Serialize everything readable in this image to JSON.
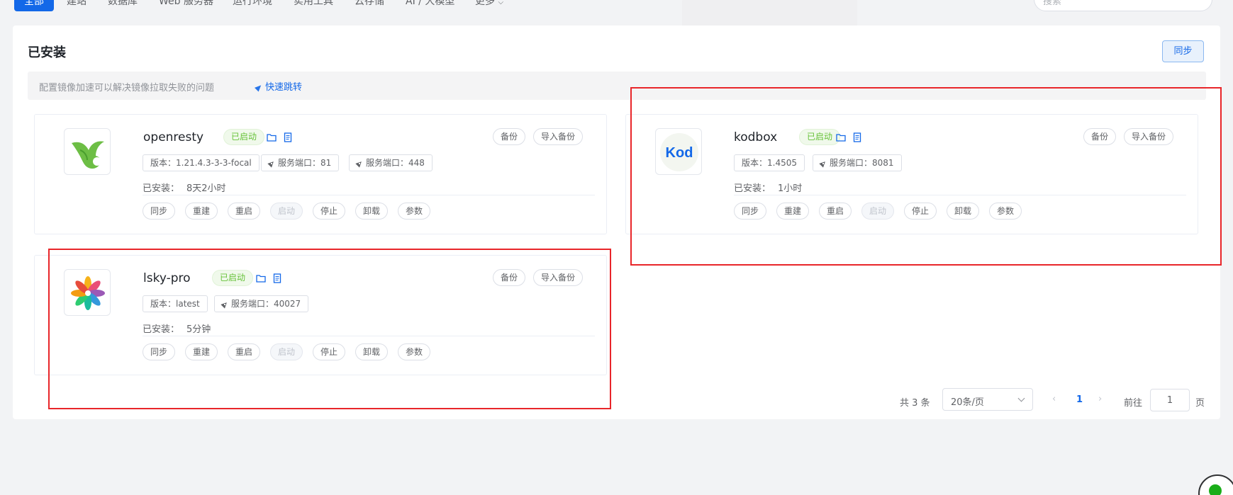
{
  "nav": {
    "tabs": [
      "全部",
      "建站",
      "数据库",
      "Web 服务器",
      "运行环境",
      "实用工具",
      "云存储",
      "AI / 大模型",
      "更多"
    ],
    "active_index": 0,
    "search_placeholder": "搜索"
  },
  "installed": {
    "title": "已安装",
    "sync_label": "同步",
    "notice_text": "配置镜像加速可以解决镜像拉取失败的问题",
    "notice_link": "快速跳转"
  },
  "apps": [
    {
      "name": "openresty",
      "status": "已启动",
      "version": "版本：1.21.4.3-3-3-focal",
      "ports": [
        "服务端口：81",
        "服务端口：448"
      ],
      "installed_label": "已安装：",
      "installed_value": "8天2小时",
      "backup_label": "备份",
      "import_label": "导入备份",
      "actions": [
        "同步",
        "重建",
        "重启",
        "启动",
        "停止",
        "卸载",
        "参数"
      ],
      "disabled_action": "启动"
    },
    {
      "name": "kodbox",
      "status": "已启动",
      "version": "版本：1.4505",
      "ports": [
        "服务端口：8081"
      ],
      "installed_label": "已安装：",
      "installed_value": "1小时",
      "backup_label": "备份",
      "import_label": "导入备份",
      "actions": [
        "同步",
        "重建",
        "重启",
        "启动",
        "停止",
        "卸载",
        "参数"
      ],
      "disabled_action": "启动"
    },
    {
      "name": "lsky-pro",
      "status": "已启动",
      "version": "版本：latest",
      "ports": [
        "服务端口：40027"
      ],
      "installed_label": "已安装：",
      "installed_value": "5分钟",
      "backup_label": "备份",
      "import_label": "导入备份",
      "actions": [
        "同步",
        "重建",
        "重启",
        "启动",
        "停止",
        "卸载",
        "参数"
      ],
      "disabled_action": "启动"
    }
  ],
  "kodbox_logo_text": "Kod",
  "pagination": {
    "total": "共 3 条",
    "page_size": "20条/页",
    "prev": "‹",
    "current_page": "1",
    "next": "›",
    "goto_label": "前往",
    "goto_value": "1",
    "unit": "页"
  },
  "colors": {
    "primary": "#1368e8",
    "success": "#67c23a",
    "highlight": "#e8262a"
  }
}
